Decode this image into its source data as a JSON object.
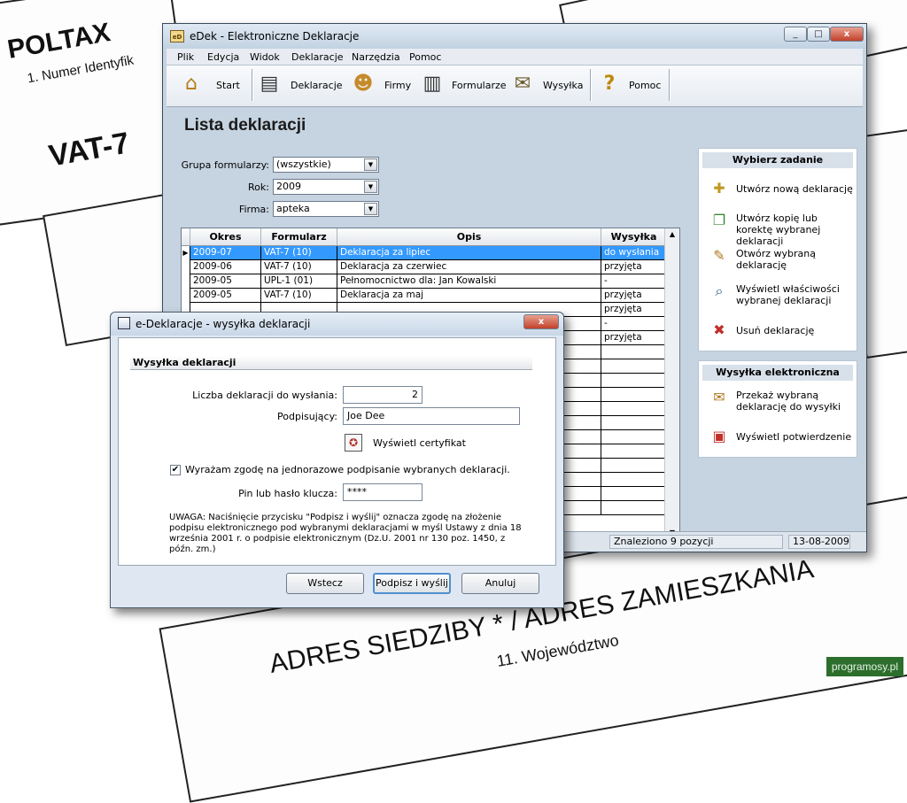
{
  "background": {
    "texts": [
      "POLTAX",
      "1. Numer Identyfik",
      "VAT-7",
      "ADRES SIEDZIBY * / ADRES ZAMIESZKANIA",
      "11. Województwo"
    ]
  },
  "window": {
    "title": "eDek - Elektroniczne Deklaracje",
    "icon_label": "eD",
    "controls": [
      "_",
      "□",
      "x"
    ]
  },
  "menu": [
    "Plik",
    "Edycja",
    "Widok",
    "Deklaracje",
    "Narzędzia",
    "Pomoc"
  ],
  "toolbar": [
    {
      "label": "Start",
      "icon": "home-icon"
    },
    {
      "label": "Deklaracje",
      "icon": "documents-icon"
    },
    {
      "label": "Firmy",
      "icon": "people-icon"
    },
    {
      "label": "Formularze",
      "icon": "forms-icon"
    },
    {
      "label": "Wysyłka",
      "icon": "envelope-icon"
    },
    {
      "label": "Pomoc",
      "icon": "question-icon"
    }
  ],
  "list": {
    "heading": "Lista deklaracji",
    "filters": [
      {
        "label": "Grupa formularzy:",
        "value": "(wszystkie)"
      },
      {
        "label": "Rok:",
        "value": "2009"
      },
      {
        "label": "Firma:",
        "value": "apteka"
      }
    ],
    "columns": [
      "Okres",
      "Formularz",
      "Opis",
      "Wysyłka"
    ],
    "rows": [
      [
        "2009-07",
        "VAT-7 (10)",
        "Deklaracja za lipiec",
        "do wysłania"
      ],
      [
        "2009-06",
        "VAT-7 (10)",
        "Deklaracja za czerwiec",
        "przyjęta"
      ],
      [
        "2009-05",
        "UPL-1 (01)",
        "Pełnomocnictwo dla: Jan Kowalski",
        "-"
      ],
      [
        "2009-05",
        "VAT-7 (10)",
        "Deklaracja za maj",
        "przyjęta"
      ],
      [
        "",
        "",
        "",
        "przyjęta"
      ],
      [
        "",
        "",
        "",
        "-"
      ],
      [
        "",
        "",
        "",
        "przyjęta"
      ]
    ],
    "empty_rows": 12
  },
  "status": {
    "found": "Znaleziono 9 pozycji",
    "date": "13-08-2009"
  },
  "tasks_panel": {
    "title": "Wybierz zadanie",
    "items": [
      {
        "label": "Utwórz nową deklarację",
        "icon": "new-document-icon"
      },
      {
        "label": "Utwórz kopię lub korektę wybranej deklaracji",
        "icon": "copy-document-icon"
      },
      {
        "label": "Otwórz wybraną deklarację",
        "icon": "edit-document-icon"
      },
      {
        "label": "Wyświetl właściwości wybranej deklaracji",
        "icon": "properties-icon"
      },
      {
        "label": "Usuń deklarację",
        "icon": "delete-icon"
      }
    ]
  },
  "send_panel": {
    "title": "Wysyłka elektroniczna",
    "items": [
      {
        "label": "Przekaż wybraną deklarację do wysyłki",
        "icon": "send-envelope-icon"
      },
      {
        "label": "Wyświetl potwierdzenie",
        "icon": "confirmation-icon"
      }
    ]
  },
  "dialog": {
    "title": "e-Deklaracje - wysyłka deklaracji",
    "section": "Wysyłka deklaracji",
    "count_label": "Liczba deklaracji do wysłania:",
    "count_value": "2",
    "signer_label": "Podpisujący:",
    "signer_value": "Joe Dee",
    "certificate_label": "Wyświetl certyfikat",
    "consent_label": "Wyrażam zgodę na jednorazowe podpisanie wybranych deklaracji.",
    "consent_checked": true,
    "pin_label": "Pin lub hasło klucza:",
    "pin_value": "****",
    "notice": "UWAGA: Naciśnięcie przycisku \"Podpisz i wyślij\" oznacza zgodę na złożenie podpisu elektronicznego pod wybranymi deklaracjami w myśl Ustawy z dnia 18 września 2001 r. o podpisie elektronicznym (Dz.U. 2001 nr 130 poz. 1450, z późn. zm.)",
    "buttons": {
      "back": "Wstecz",
      "sign_send": "Podpisz i wyślij",
      "cancel": "Anuluj"
    }
  },
  "watermark": "programosy.pl",
  "colors": {
    "selection": "#3399ff",
    "window_bg": "#c6d3e0",
    "panel_head": "#d8e0ea"
  }
}
